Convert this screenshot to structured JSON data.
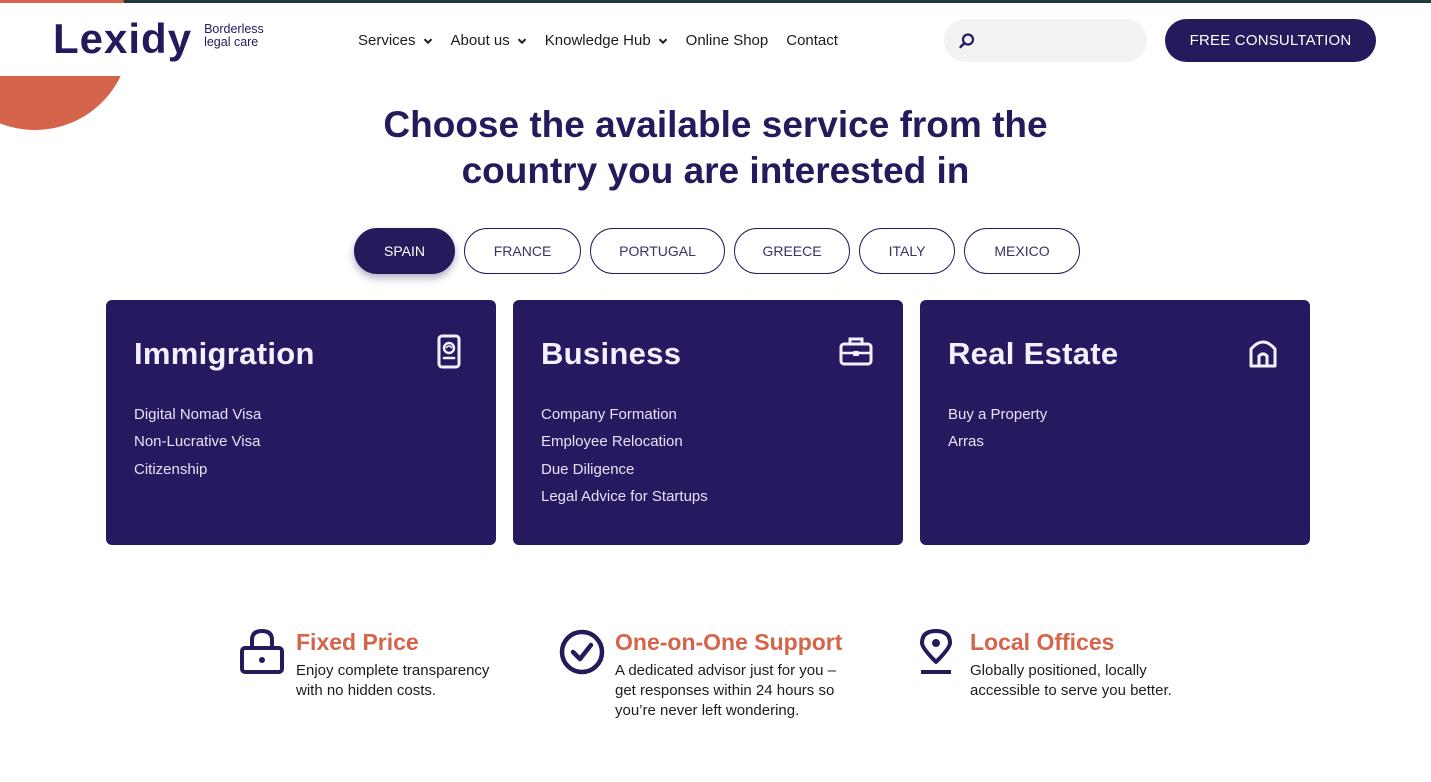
{
  "brand": {
    "name": "Lexidy",
    "logo_text": "Lexidy",
    "tagline_line1": "Borderless",
    "tagline_line2": "legal care"
  },
  "nav": {
    "items": [
      {
        "label": "Services",
        "has_dropdown": true
      },
      {
        "label": "About us",
        "has_dropdown": true
      },
      {
        "label": "Knowledge Hub",
        "has_dropdown": true
      },
      {
        "label": "Online Shop",
        "has_dropdown": false
      },
      {
        "label": "Contact",
        "has_dropdown": false
      }
    ]
  },
  "search": {
    "placeholder": "",
    "icon": "search-icon"
  },
  "cta": {
    "label": "FREE CONSULTATION"
  },
  "hero": {
    "line1": "Choose the available service from the",
    "line2": "country you are interested in"
  },
  "country_tabs": {
    "selected": "SPAIN",
    "items": [
      {
        "label": "SPAIN"
      },
      {
        "label": "FRANCE"
      },
      {
        "label": "PORTUGAL"
      },
      {
        "label": "GREECE"
      },
      {
        "label": "ITALY"
      },
      {
        "label": "MEXICO"
      }
    ]
  },
  "service_cards": [
    {
      "title": "Immigration",
      "icon": "passport-icon",
      "links": [
        "Digital Nomad Visa",
        "Non-Lucrative Visa",
        "Citizenship"
      ]
    },
    {
      "title": "Business",
      "icon": "briefcase-icon",
      "links": [
        "Company Formation",
        "Employee Relocation",
        "Due Diligence",
        "Legal Advice for Startups"
      ]
    },
    {
      "title": "Real Estate",
      "icon": "house-icon",
      "links": [
        "Buy a Property",
        "Arras"
      ]
    }
  ],
  "features": [
    {
      "title": "Fixed Price",
      "icon": "lock-icon",
      "text": "Enjoy complete transparency with no hidden costs."
    },
    {
      "title": "One-on-One Support",
      "icon": "check-circle-icon",
      "text": "A dedicated advisor just for you – get responses within 24 hours so you’re never left wondering."
    },
    {
      "title": "Local Offices",
      "icon": "location-pin-icon",
      "text": "Globally positioned, locally accessible to serve you better."
    }
  ],
  "colors": {
    "primary": "#241a5c",
    "card_bg": "#261960",
    "accent": "#d4644a",
    "search_bg": "#f2f2f2"
  }
}
